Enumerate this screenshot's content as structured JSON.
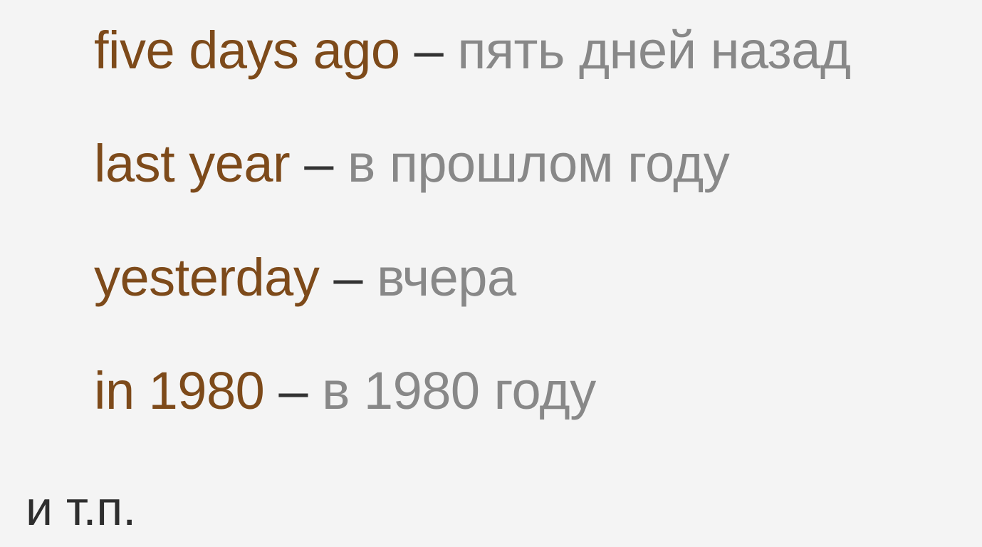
{
  "colors": {
    "background": "#f4f4f4",
    "english_text": "#7d4a1a",
    "dash": "#333333",
    "russian_text": "#888888",
    "footer_text": "#2e2e2e"
  },
  "examples": [
    {
      "english": "five days ago",
      "dash": " – ",
      "russian": "пять дней назад"
    },
    {
      "english": "last year",
      "dash": " – ",
      "russian": "в прошлом году"
    },
    {
      "english": "yesterday",
      "dash": " – ",
      "russian": "вчера"
    },
    {
      "english": "in 1980",
      "dash": " – ",
      "russian": "в 1980 году"
    }
  ],
  "footer": {
    "text": "и т.п."
  }
}
